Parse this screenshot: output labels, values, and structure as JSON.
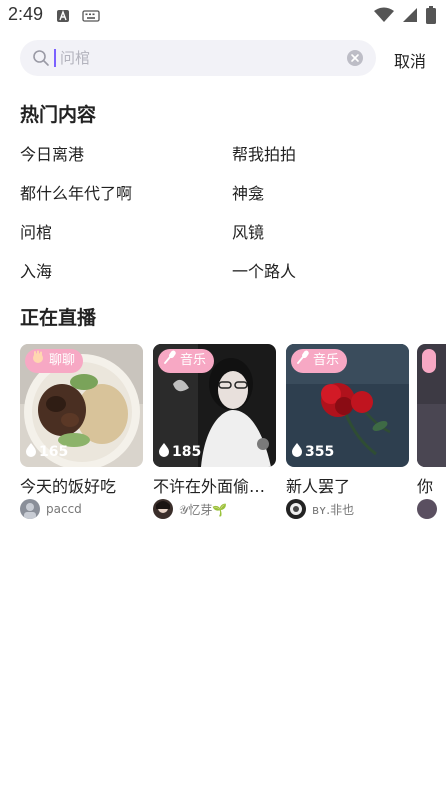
{
  "status_bar": {
    "time": "2:49"
  },
  "search": {
    "placeholder": "问棺",
    "cancel_label": "取消"
  },
  "hot": {
    "title": "热门内容",
    "items": [
      "今日离港",
      "帮我拍拍",
      "都什么年代了啊",
      "神龛",
      "问棺",
      "风镜",
      "入海",
      "一个路人"
    ]
  },
  "live": {
    "title": "正在直播",
    "cards": [
      {
        "tag": "聊聊",
        "tag_icon": "hand-icon",
        "count": "165",
        "title": "今天的饭好吃",
        "author": "paccd"
      },
      {
        "tag": "音乐",
        "tag_icon": "mic-icon",
        "count": "185",
        "title": "不许在外面偷…",
        "author": "𝒴忆芽🌱"
      },
      {
        "tag": "音乐",
        "tag_icon": "mic-icon",
        "count": "355",
        "title": "新人罢了",
        "author": "ʙʏ.非也"
      },
      {
        "tag": "",
        "count": "",
        "title": "你",
        "author": ""
      }
    ]
  },
  "colors": {
    "accent": "#7b61ff",
    "tag_pink": "#f7a8c4",
    "search_bg": "#f2f2f7"
  }
}
